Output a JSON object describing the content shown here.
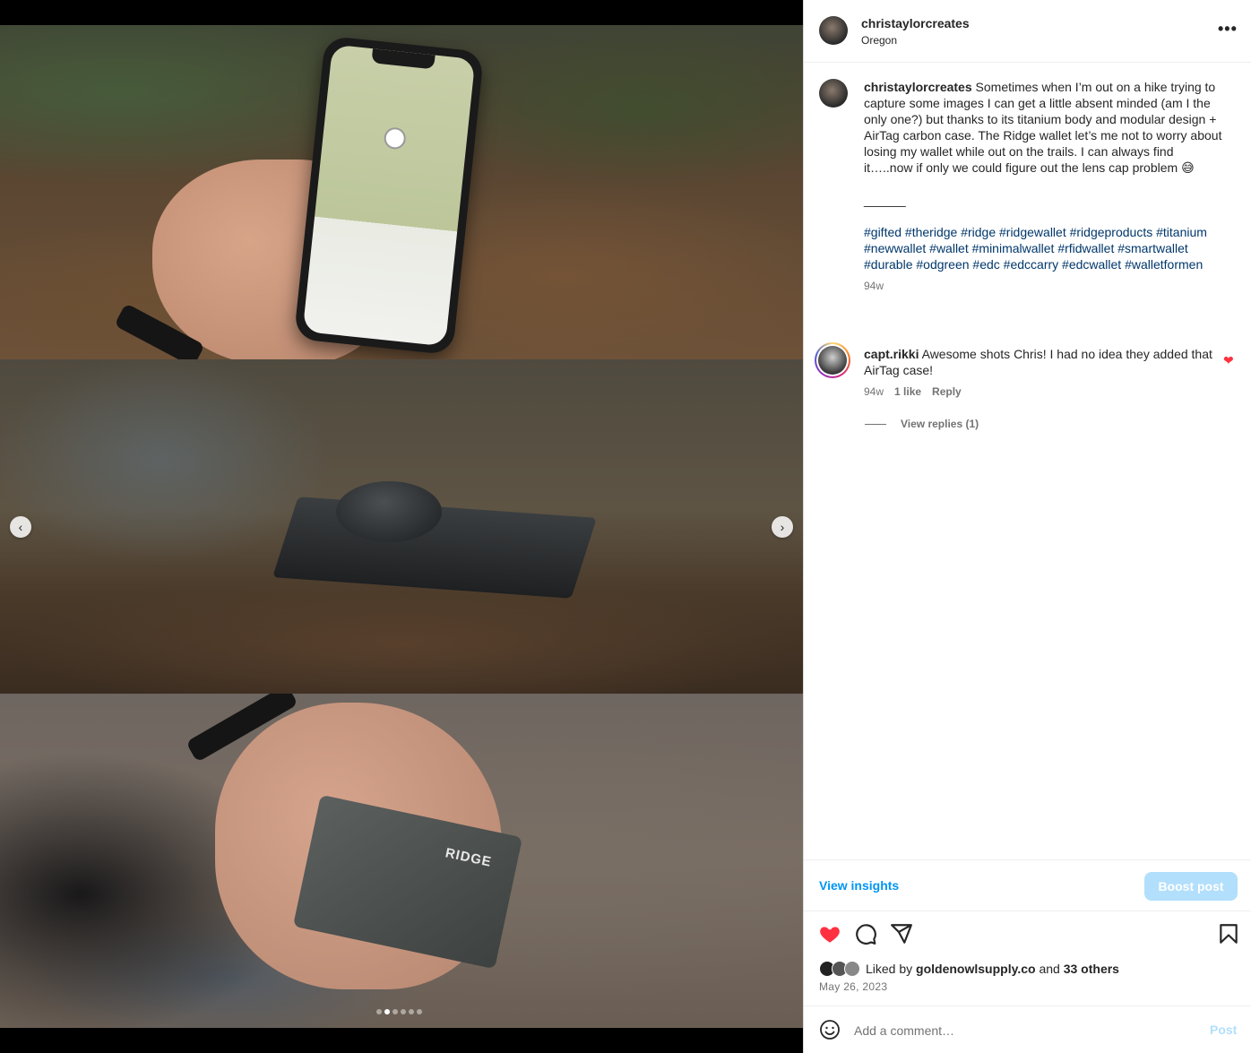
{
  "post": {
    "username": "christaylorcreates",
    "location": "Oregon",
    "more_label": "•••"
  },
  "media": {
    "carousel_index": 2,
    "carousel_total": 6,
    "prev_label": "‹",
    "next_label": "›",
    "wallet_brand": "RIDGE"
  },
  "caption": {
    "username": "christaylorcreates",
    "text": "Sometimes when I’m out on a hike trying to capture some images I can get a little absent minded (am I the only one?) but thanks to its titanium body and modular design + AirTag carbon case. The Ridge wallet let’s me not to worry about losing my wallet while out on the trails. I can always find it…..now if only we could figure out the lens cap problem 😅",
    "divider": "______",
    "hashtags": "#gifted #theridge #ridge #ridgewallet #ridgeproducts #titanium #newwallet #wallet #minimalwallet #rfidwallet #smartwallet #durable #odgreen #edc #edccarry #edcwallet #walletformen",
    "time": "94w"
  },
  "comment": {
    "username": "capt.rikki",
    "text": "Awesome shots Chris! I had no idea they added that AirTag case!",
    "time": "94w",
    "likes": "1 like",
    "reply": "Reply",
    "view_replies": "View replies (1)",
    "liked": true
  },
  "insights": {
    "view_insights": "View insights",
    "boost": "Boost post"
  },
  "actions": {
    "liked": true,
    "icons": [
      "heart-icon",
      "comment-icon",
      "share-icon",
      "bookmark-icon"
    ]
  },
  "likes": {
    "prefix": "Liked by",
    "user": "goldenowlsupply.co",
    "and": "and",
    "others": "33 others"
  },
  "date": "May 26, 2023",
  "add_comment": {
    "placeholder": "Add a comment…",
    "post_label": "Post"
  },
  "colors": {
    "accent": "#0095f6",
    "accent_disabled": "#b2dffc",
    "like_red": "#ff3040",
    "hashtag": "#00376b",
    "muted": "#737373"
  }
}
